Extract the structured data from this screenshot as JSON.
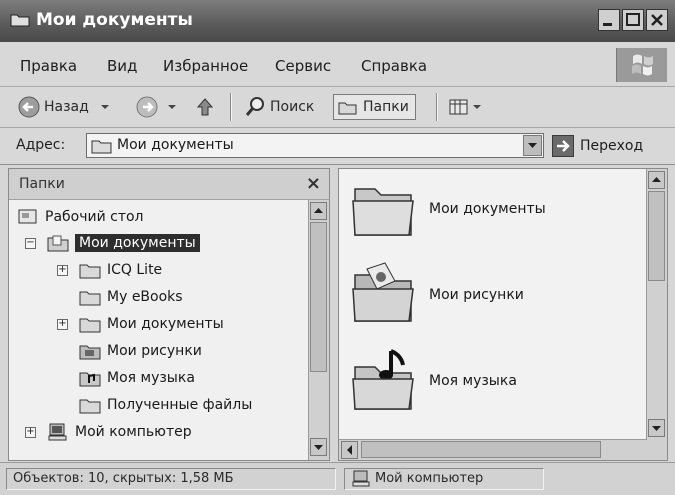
{
  "window": {
    "title": "Мои документы"
  },
  "menu": [
    "Правка",
    "Вид",
    "Избранное",
    "Сервис",
    "Справка"
  ],
  "toolbar": {
    "back": "Назад",
    "search": "Поиск",
    "folders": "Папки"
  },
  "address": {
    "label": "Адрес:",
    "value": "Мои документы",
    "go": "Переход"
  },
  "folders_pane": {
    "title": "Папки",
    "close": "×",
    "items": [
      {
        "label": "Рабочий стол"
      },
      {
        "label": "Мои документы"
      },
      {
        "label": "ICQ Lite"
      },
      {
        "label": "My eBooks"
      },
      {
        "label": "Мои документы"
      },
      {
        "label": "Мои рисунки"
      },
      {
        "label": "Моя музыка"
      },
      {
        "label": "Полученные файлы"
      },
      {
        "label": "Мой компьютер"
      }
    ]
  },
  "content": {
    "items": [
      {
        "label": "Мои документы",
        "icon": "folder-icon"
      },
      {
        "label": "Мои рисунки",
        "icon": "pictures-folder-icon"
      },
      {
        "label": "Моя музыка",
        "icon": "music-folder-icon"
      }
    ]
  },
  "status": {
    "objects": "Объектов: 10, скрытых: 1,58 МБ",
    "location": "Мой компьютер"
  },
  "colors": {
    "titlebar": "#5a5a5a",
    "selection": "#2e2e2e",
    "window_bg": "#d6d6d6"
  }
}
